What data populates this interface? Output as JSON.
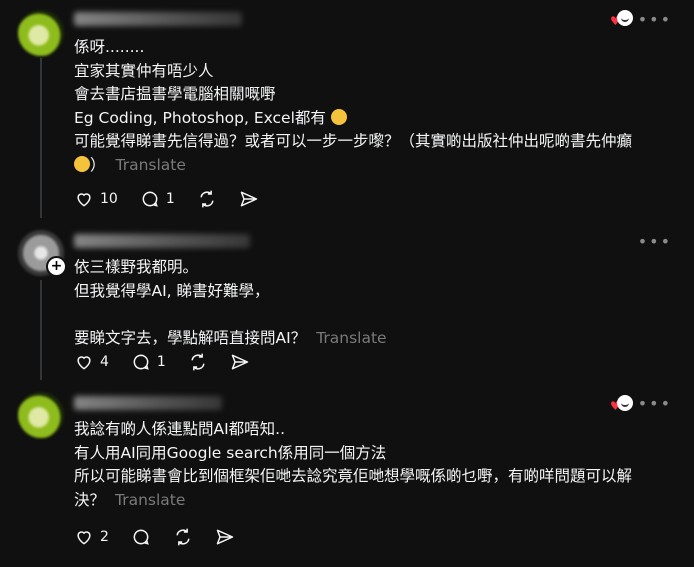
{
  "posts": [
    {
      "lines": [
        "係呀........",
        "宜家其實仲有唔少人",
        "會去書店揾書學電腦相關嘅嘢",
        "Eg Coding, Photoshop, Excel都有",
        "可能覺得睇書先信得過？或者可以一步一步嚟？（其實啲出版社仲出呢啲書先仲癲",
        "）"
      ],
      "translate": "Translate",
      "likes": "10",
      "replies": "1",
      "liked_by_author": true
    },
    {
      "lines": [
        "依三樣野我都明。",
        "但我覺得學AI, 睇書好難學，",
        "",
        "要睇文字去，學點解唔直接問AI？"
      ],
      "translate": "Translate",
      "likes": "4",
      "replies": "1",
      "liked_by_author": false
    },
    {
      "lines": [
        "我諗有啲人係連點問AI都唔知..",
        "有人用AI同用Google search係用同一個方法",
        "所以可能睇書會比到個框架佢哋去諗究竟佢哋想學嘅係啲乜嘢，有啲咩問題可以解",
        "決？"
      ],
      "translate": "Translate",
      "likes": "2",
      "replies": "",
      "liked_by_author": true
    }
  ],
  "more_label": "•••",
  "colors": {
    "accent_heart": "#ff3040",
    "background": "#101010",
    "muted": "#7a7a7a"
  }
}
